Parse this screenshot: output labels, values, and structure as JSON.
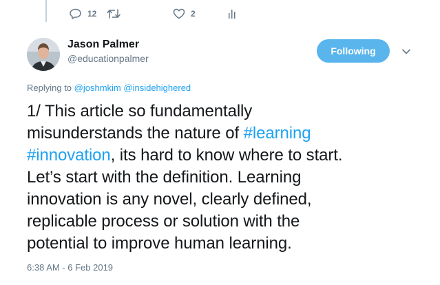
{
  "previous_tweet": {
    "reply_count": "12",
    "like_count": "2"
  },
  "author": {
    "name": "Jason Palmer",
    "handle": "@educationpalmer"
  },
  "follow_button_label": "Following",
  "replying_to": {
    "prefix": "Replying to",
    "mentions": [
      "@joshmkim",
      "@insidehighered"
    ]
  },
  "tweet": {
    "lines": [
      [
        {
          "t": "1/ This article so fundamentally",
          "tag": false
        }
      ],
      [
        {
          "t": "misunderstands the nature of ",
          "tag": false
        },
        {
          "t": "#learning",
          "tag": true
        }
      ],
      [
        {
          "t": "#innovation",
          "tag": true
        },
        {
          "t": ", its hard to know where to start.",
          "tag": false
        }
      ],
      [
        {
          "t": "Let’s start with the definition. Learning",
          "tag": false
        }
      ],
      [
        {
          "t": "innovation is any novel, clearly defined,",
          "tag": false
        }
      ],
      [
        {
          "t": "replicable process or solution with the",
          "tag": false
        }
      ],
      [
        {
          "t": "potential to improve human learning.",
          "tag": false
        }
      ]
    ]
  },
  "timestamp": "6:38 AM - 6 Feb 2019",
  "colors": {
    "link": "#1da1f2",
    "follow_button": "#59b5ec",
    "muted_text": "#657786"
  }
}
